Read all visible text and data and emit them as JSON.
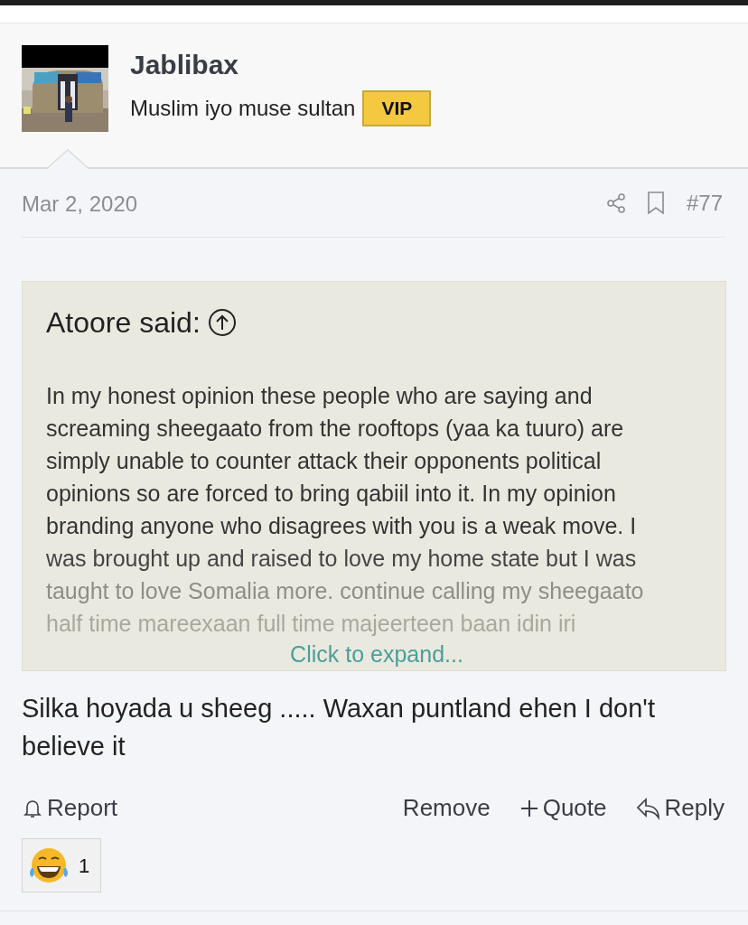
{
  "author": {
    "name": "Jablibax",
    "title": "Muslim iyo muse sultan",
    "badge": "VIP"
  },
  "post": {
    "date": "Mar 2, 2020",
    "number": "#77"
  },
  "quote": {
    "attribution": "Atoore said:",
    "lines": [
      "In my honest opinion these people who are saying and",
      "screaming sheegaato from the rooftops (yaa ka tuuro) are",
      "simply unable to counter attack their opponents political",
      "opinions so are forced to bring qabiil into it. In my opinion",
      "branding anyone who disagrees with you is a weak move. I",
      "was brought up and raised to love my home state but I was",
      "taught to love Somalia more. continue calling my sheegaato",
      "half time mareexaan full time majeerteen baan idin iri"
    ],
    "expand": "Click to expand..."
  },
  "message": "Silka hoyada u sheeg ..... Waxan puntland ehen I don't believe it",
  "actions": {
    "report": "Report",
    "right": [
      {
        "kind": "remove",
        "label": "Remove"
      },
      {
        "kind": "quote",
        "label": "Quote"
      },
      {
        "kind": "reply",
        "label": "Reply"
      }
    ]
  },
  "reactions": [
    {
      "count": "1"
    }
  ]
}
